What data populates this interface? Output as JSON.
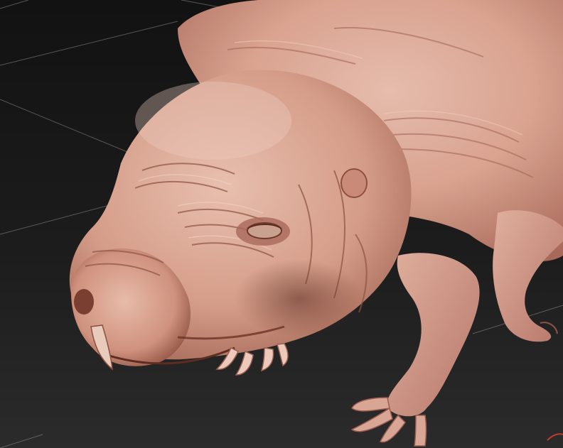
{
  "scene": {
    "subject": "sculpted-creature-model",
    "icons": [
      "grid-floor",
      "creature-head",
      "creature-eye",
      "creature-tusk",
      "creature-claws",
      "creature-foreleg"
    ],
    "colors": {
      "background_top": "#141414",
      "background_bottom": "#2a2a2a",
      "grid_line": "#8a8a8a",
      "skin_light": "#e2b4a4",
      "skin_mid": "#cf9582",
      "skin_shadow": "#9c5f4d",
      "skin_deep": "#6e3a2c",
      "tusk": "#e8c9b8",
      "accent_red": "#c0392b"
    }
  }
}
